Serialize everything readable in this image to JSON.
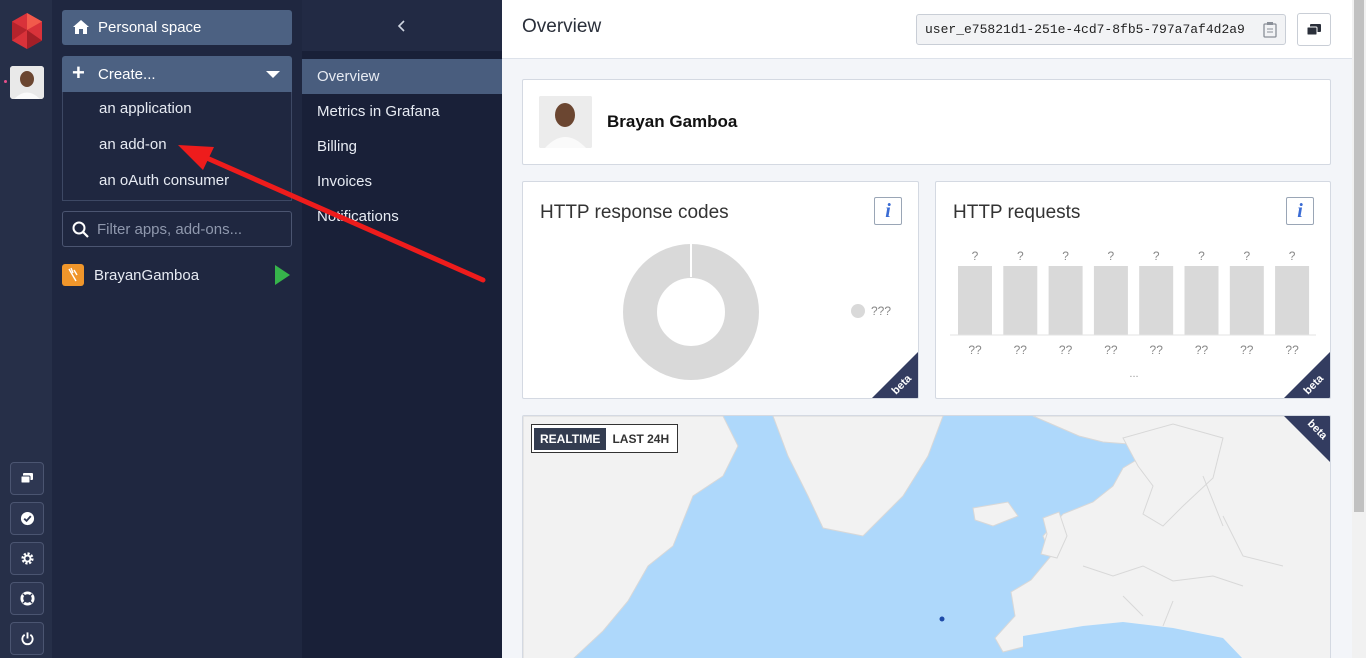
{
  "rail": {
    "logo_icon": "clever-cloud-logo",
    "bottom_icons": [
      "chat-icon",
      "check-circle-icon",
      "gear-icon",
      "lifebuoy-icon",
      "power-icon"
    ]
  },
  "sidebar": {
    "personal_space": "Personal space",
    "create_label": "Create...",
    "create_items": [
      "an application",
      "an add-on",
      "an oAuth consumer"
    ],
    "filter_placeholder": "Filter apps, add-ons...",
    "apps": [
      {
        "name": "BrayanGamboa"
      }
    ]
  },
  "nav": {
    "items": [
      "Overview",
      "Metrics in Grafana",
      "Billing",
      "Invoices",
      "Notifications"
    ],
    "active": "Overview"
  },
  "header": {
    "title": "Overview",
    "user_id": "user_e75821d1-251e-4cd7-8fb5-797a7af4d2a9"
  },
  "profile": {
    "name": "Brayan Gamboa"
  },
  "http_codes": {
    "title": "HTTP response codes",
    "info": "i",
    "legend": "???",
    "badge": "beta"
  },
  "http_requests": {
    "title": "HTTP requests",
    "info": "i",
    "bar_labels": [
      "?",
      "?",
      "?",
      "?",
      "?",
      "?",
      "?",
      "?"
    ],
    "x_labels": [
      "??",
      "??",
      "??",
      "??",
      "??",
      "??",
      "??",
      "??"
    ],
    "footer": "...",
    "badge": "beta"
  },
  "map": {
    "toggle_on": "REALTIME",
    "toggle_off": "LAST 24H",
    "badge": "beta"
  },
  "colors": {
    "rail_bg": "#262f48",
    "sidebar_bg": "#1f2740",
    "nav_active": "#495d7e",
    "accent_red": "#e8403a",
    "badge_bg": "#333c60",
    "app_icon": "#f0962b",
    "play_green": "#36b44b"
  }
}
